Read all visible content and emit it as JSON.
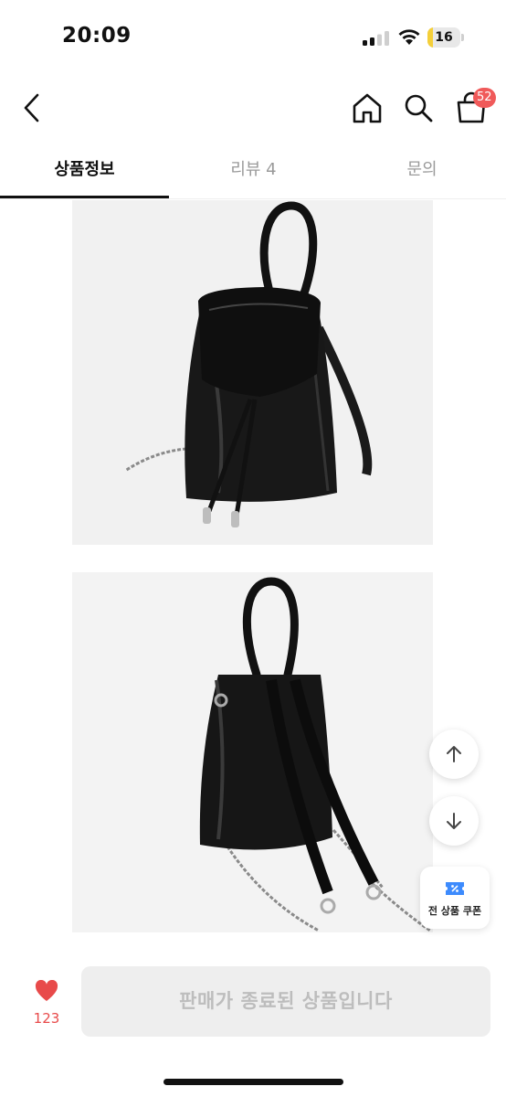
{
  "status_bar": {
    "time": "20:09",
    "battery_level": "16",
    "battery_fraction": 0.16,
    "battery_color": "#f4cf3a"
  },
  "header": {
    "back_icon": "chevron-left-icon",
    "home_icon": "home-icon",
    "search_icon": "search-icon",
    "cart_icon": "shopping-bag-icon",
    "cart_count": "52",
    "badge_color": "#f05a5a"
  },
  "tabs": [
    {
      "label": "상품정보",
      "active": true
    },
    {
      "label": "리뷰 4",
      "active": false
    },
    {
      "label": "문의",
      "active": false
    }
  ],
  "floating": {
    "scroll_up_icon": "arrow-up-icon",
    "scroll_down_icon": "arrow-down-icon",
    "coupon_icon": "coupon-icon",
    "coupon_label": "전 상품 쿠폰"
  },
  "bottom_bar": {
    "like_icon": "heart-icon",
    "like_count": "123",
    "like_color": "#e84a4a",
    "purchase_label": "판매가 종료된 상품입니다"
  }
}
